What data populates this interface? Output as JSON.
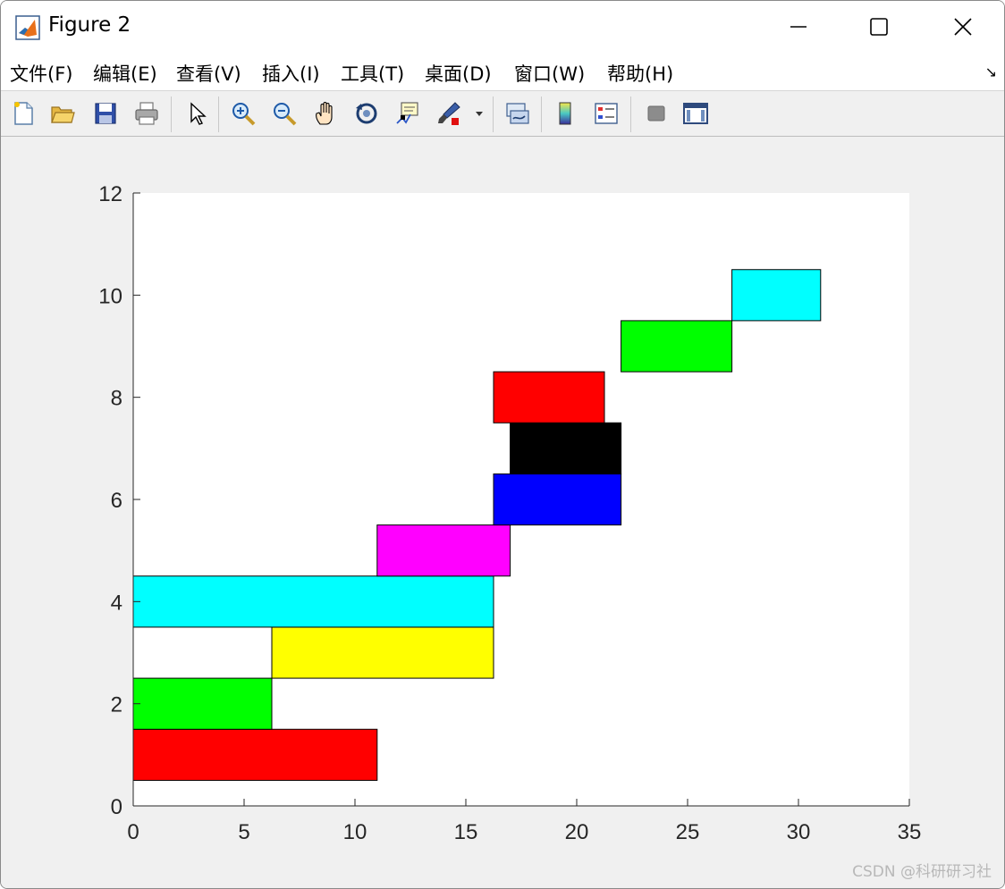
{
  "window": {
    "title": "Figure 2",
    "controls": {
      "minimize": "minimize",
      "maximize": "maximize",
      "close": "close"
    }
  },
  "menubar": {
    "items": [
      {
        "label": "文件(F)"
      },
      {
        "label": "编辑(E)"
      },
      {
        "label": "查看(V)"
      },
      {
        "label": "插入(I)"
      },
      {
        "label": "工具(T)"
      },
      {
        "label": "桌面(D)"
      },
      {
        "label": "窗口(W)"
      },
      {
        "label": "帮助(H)"
      }
    ]
  },
  "toolbar": {
    "icons": [
      "new-file-icon",
      "open-folder-icon",
      "save-icon",
      "print-icon",
      "pointer-icon",
      "zoom-in-icon",
      "zoom-out-icon",
      "pan-hand-icon",
      "rotate-3d-icon",
      "data-cursor-icon",
      "brush-icon",
      "link-plot-icon",
      "colorbar-icon",
      "legend-icon",
      "hide-plot-tools-icon",
      "show-plot-tools-icon"
    ]
  },
  "chart_data": {
    "type": "bar",
    "subtype": "gantt",
    "title": "",
    "xlabel": "",
    "ylabel": "",
    "xlim": [
      0,
      35
    ],
    "ylim": [
      0,
      12
    ],
    "xticks": [
      0,
      5,
      10,
      15,
      20,
      25,
      30,
      35
    ],
    "yticks": [
      0,
      2,
      4,
      6,
      8,
      10,
      12
    ],
    "grid": false,
    "bars": [
      {
        "y": 1,
        "start": 0,
        "end": 11,
        "color": "#ff0000"
      },
      {
        "y": 2,
        "start": 0,
        "end": 6.25,
        "color": "#00ff00"
      },
      {
        "y": 3,
        "start": 6.25,
        "end": 16.25,
        "color": "#ffff00"
      },
      {
        "y": 4,
        "start": 0,
        "end": 16.25,
        "color": "#00ffff"
      },
      {
        "y": 5,
        "start": 11,
        "end": 17,
        "color": "#ff00ff"
      },
      {
        "y": 6,
        "start": 16.25,
        "end": 22,
        "color": "#0000ff"
      },
      {
        "y": 7,
        "start": 17,
        "end": 22,
        "color": "#000000"
      },
      {
        "y": 8,
        "start": 16.25,
        "end": 21.25,
        "color": "#ff0000"
      },
      {
        "y": 9,
        "start": 22,
        "end": 27,
        "color": "#00ff00"
      },
      {
        "y": 10,
        "start": 27,
        "end": 31,
        "color": "#00ffff"
      }
    ],
    "bar_height": 1
  },
  "watermark": {
    "text": "CSDN @科研研习社"
  }
}
